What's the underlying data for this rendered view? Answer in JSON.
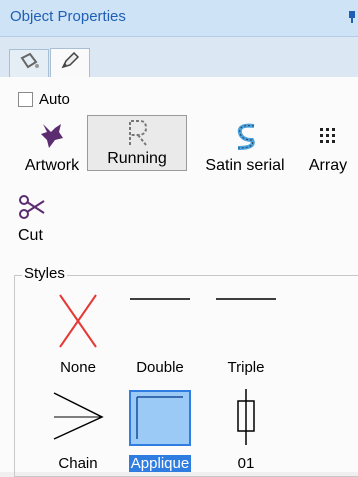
{
  "panel": {
    "title": "Object Properties",
    "accent": "#1f5fb5"
  },
  "tabs": [
    {
      "icon": "bucket-icon",
      "selected": false
    },
    {
      "icon": "pencil-icon",
      "selected": true
    }
  ],
  "auto": {
    "label": "Auto",
    "checked": false
  },
  "tools": [
    {
      "id": "artwork",
      "label": "Artwork",
      "icon": "artwork-icon",
      "selected": false
    },
    {
      "id": "running",
      "label": "Running",
      "icon": "running-stitch-icon",
      "selected": true
    },
    {
      "id": "satin-serial",
      "label": "Satin serial",
      "icon": "satin-serial-icon",
      "selected": false
    },
    {
      "id": "array",
      "label": "Array",
      "icon": "array-icon",
      "selected": false
    },
    {
      "id": "cut",
      "label": "Cut",
      "icon": "scissors-icon",
      "selected": false
    }
  ],
  "styles": {
    "title": "Styles",
    "items": [
      {
        "id": "none",
        "label": "None",
        "icon": "red-x-icon",
        "selected": false
      },
      {
        "id": "double",
        "label": "Double",
        "icon": "line-icon",
        "selected": false
      },
      {
        "id": "triple",
        "label": "Triple",
        "icon": "line-icon",
        "selected": false
      },
      {
        "id": "chain",
        "label": "Chain",
        "icon": "chain-triangle-icon",
        "selected": false
      },
      {
        "id": "applique",
        "label": "Applique",
        "icon": "applique-square-icon",
        "selected": true
      },
      {
        "id": "01",
        "label": "01",
        "icon": "pattern-01-icon",
        "selected": false
      }
    ],
    "selected_color": "#2f7de1"
  }
}
